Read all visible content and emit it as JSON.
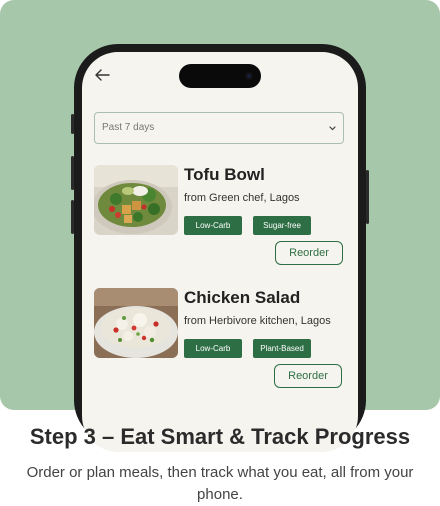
{
  "colors": {
    "hero_bg": "#a6c7a9",
    "accent": "#2e6e45",
    "screen_bg": "#f6f4ee"
  },
  "screen": {
    "back_icon": "arrow-left-icon",
    "filter": {
      "value": "Past 7 days",
      "icon": "chevron-down-icon"
    },
    "meals": [
      {
        "title": "Tofu Bowl",
        "source": "from Green chef, Lagos",
        "tags": [
          "Low-Carb",
          "Sugar-free"
        ],
        "reorder_label": "Reorder"
      },
      {
        "title": "Chicken Salad",
        "source": "from Herbivore kitchen, Lagos",
        "tags": [
          "Low-Carb",
          "Plant-Based"
        ],
        "reorder_label": "Reorder"
      }
    ]
  },
  "caption": {
    "title": "Step 3 – Eat Smart & Track Progress",
    "body": "Order or plan meals, then track what you eat, all from your phone."
  }
}
